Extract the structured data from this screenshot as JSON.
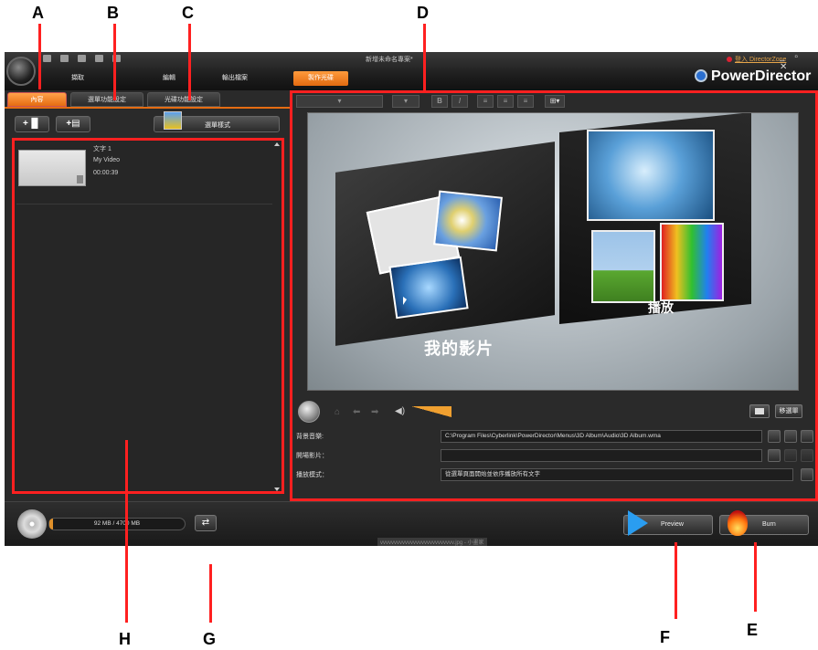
{
  "callouts": {
    "a": "A",
    "b": "B",
    "c": "C",
    "d": "D",
    "e": "E",
    "f": "F",
    "g": "G",
    "h": "H"
  },
  "window": {
    "title": "新增未命名專案*",
    "login": "登入 DirectorZone",
    "controls": "_ ▫ ✕",
    "brand": "PowerDirector"
  },
  "main_tabs": [
    "擷取",
    "編輯",
    "輸出檔案",
    "製作光碟"
  ],
  "sub_tabs": [
    "內容",
    "選單功能設定",
    "光碟功能設定"
  ],
  "toolbar": {
    "add_title_label": "+▐▌",
    "add_video_label": "+▤",
    "select_style_label": "選單樣式"
  },
  "content_list": {
    "items": [
      {
        "title": "文字 1",
        "name": "My Video",
        "duration": "00:00:39"
      }
    ]
  },
  "preview": {
    "play_caption": "播放",
    "movie_caption": "我的影片"
  },
  "player": {
    "menu_button": "移選單",
    "nav_icons": [
      "⌂",
      "⬅",
      "➡"
    ],
    "volume_icon": "◀)"
  },
  "properties": {
    "bgm_label": "背景音樂:",
    "bgm_path": "C:\\Program Files\\Cyberlink\\PowerDirector\\Menus\\3D Album\\Audio\\3D Album.wma",
    "intro_label": "開場影片：",
    "intro_value": "",
    "playmode_label": "播放模式：",
    "playmode_value": "從選單頁面開始並依序播放所有文字"
  },
  "bottom": {
    "capacity_text": "92 MB / 4700 MB",
    "capacity_used_fraction": 0.02,
    "swap_icon": "⇄",
    "filename": "vvvvvvvvvvvvvvvvvvvvvvvvvvv.jpg - 小畫家",
    "preview_label": "Preview",
    "burn_label": "Burn"
  },
  "colors": {
    "accent_orange": "#e56c12",
    "annotation_red": "#ff2020",
    "preview_blue": "#2a9df0"
  }
}
